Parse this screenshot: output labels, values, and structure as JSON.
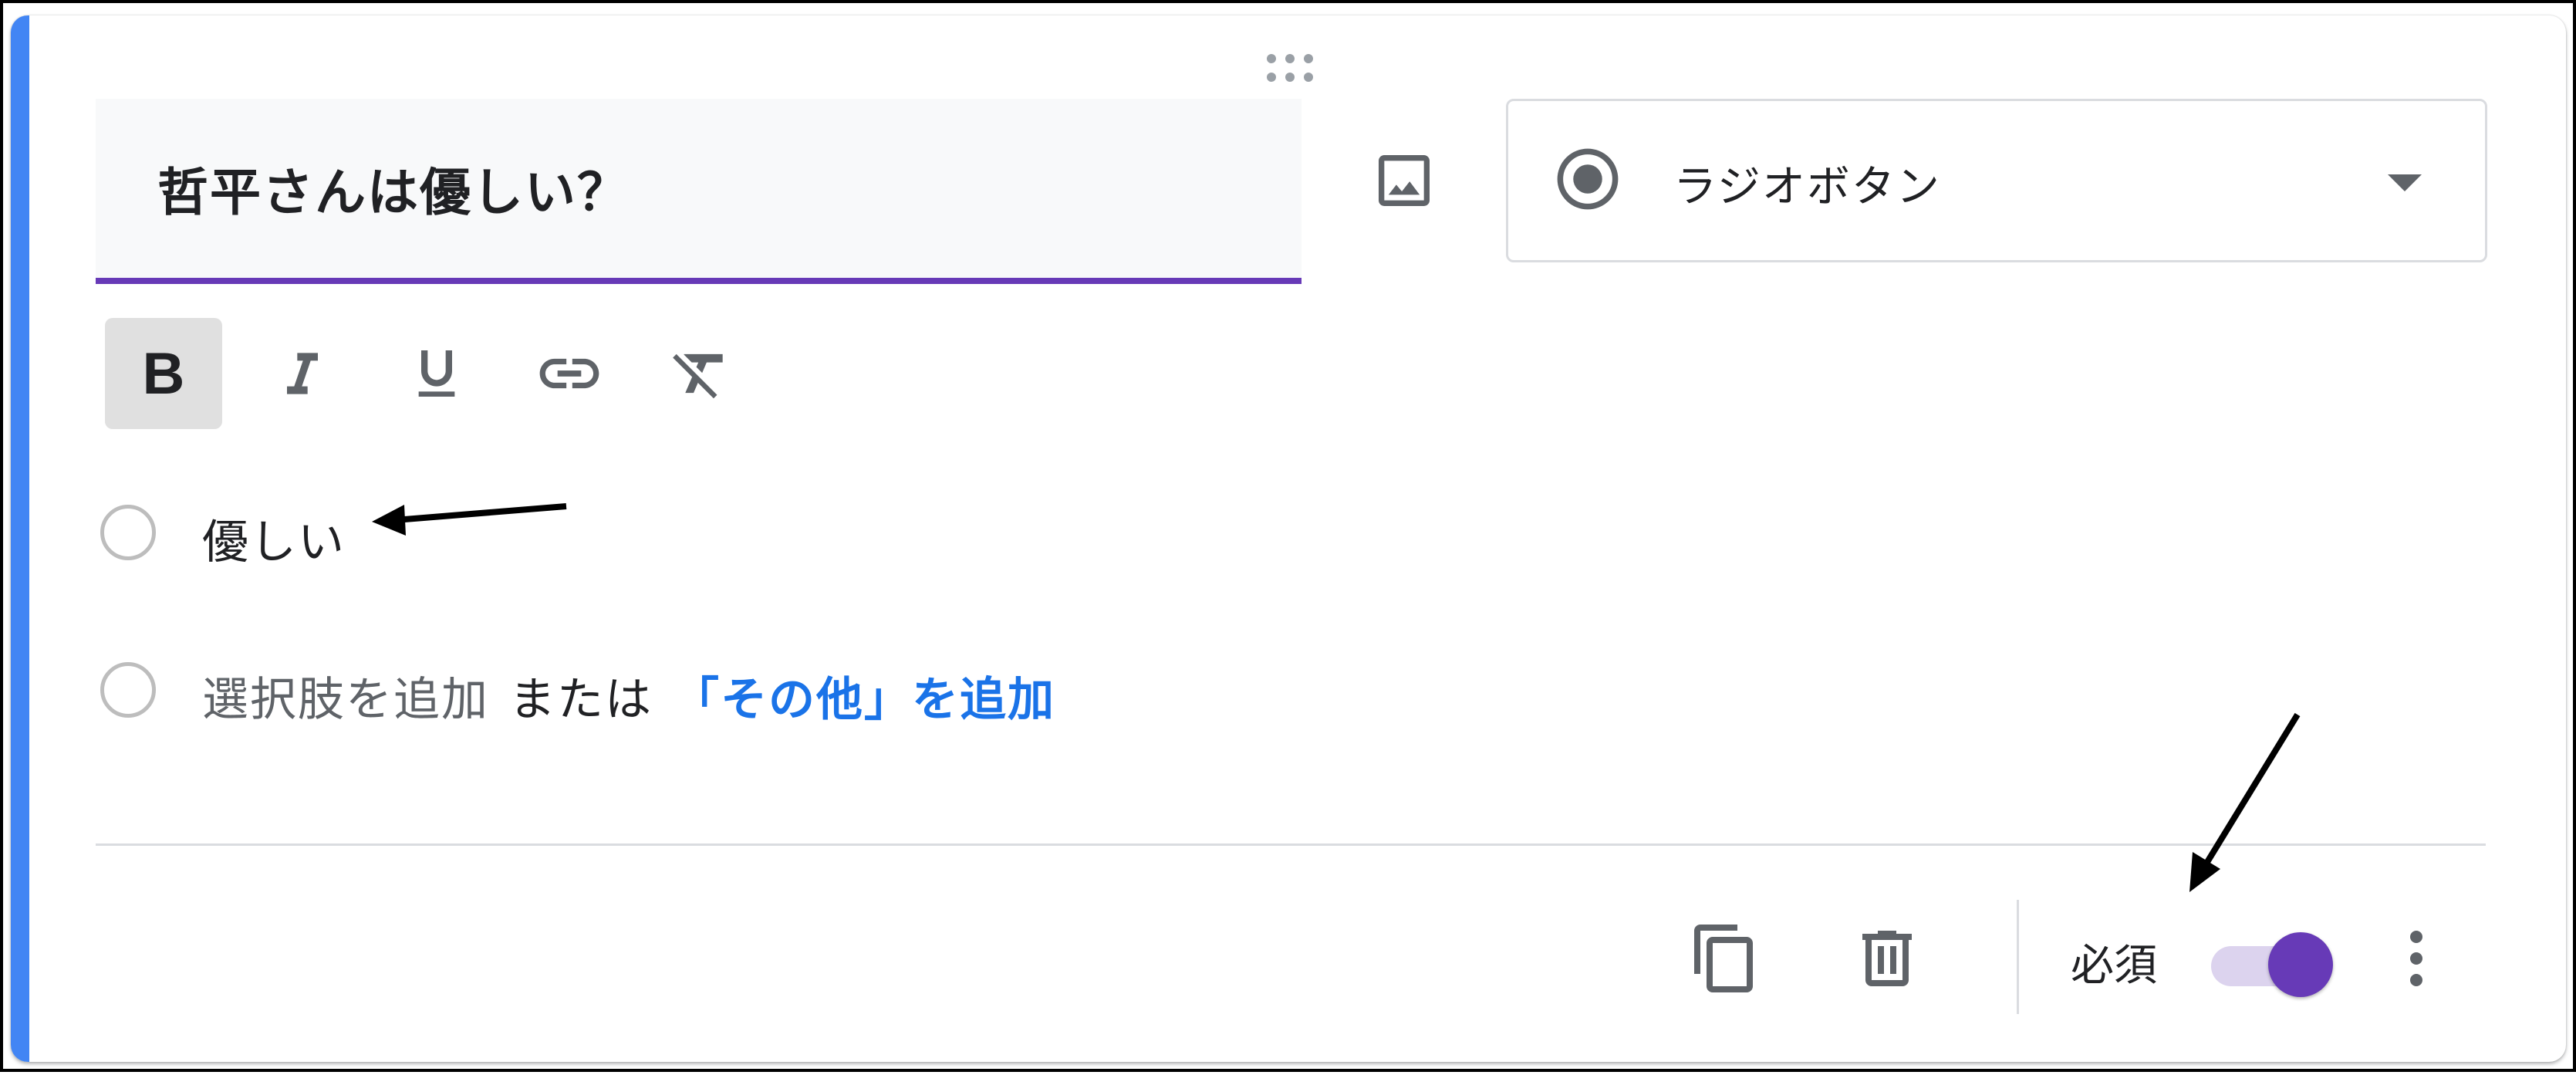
{
  "question": {
    "title": "哲平さんは優しい？",
    "type_label": "ラジオボタン"
  },
  "options": [
    {
      "label": "優しい"
    }
  ],
  "add_option": {
    "add_label": "選択肢を追加",
    "or_label": "または",
    "add_other_label": "「その他」を追加"
  },
  "footer": {
    "required_label": "必須",
    "required_on": true
  },
  "formatting_toolbar": {
    "bold_label": "B",
    "icons": [
      "bold-icon",
      "italic-icon",
      "underline-icon",
      "link-icon",
      "clear-format-icon"
    ]
  },
  "colors": {
    "accent_bar": "#4285f4",
    "theme": "#673ab7",
    "link": "#1a73e8"
  }
}
